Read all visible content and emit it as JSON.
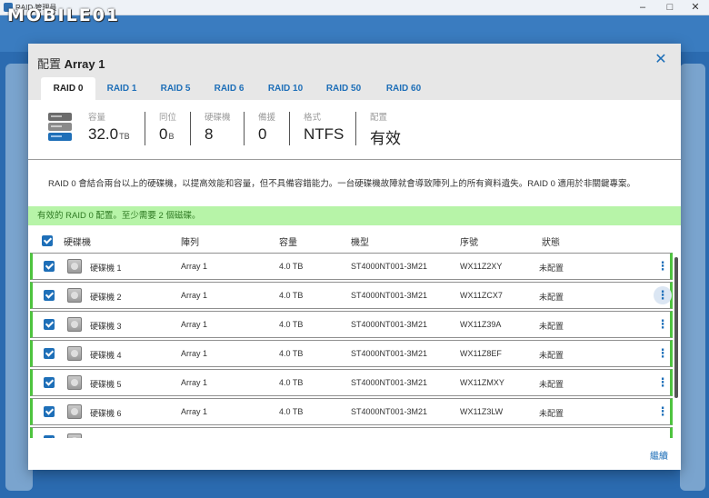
{
  "window": {
    "title": "RAID 管理員"
  },
  "watermark": "MOBILE01",
  "dialog": {
    "title_prefix": "配置",
    "title_name": "Array 1",
    "tabs": [
      "RAID 0",
      "RAID 1",
      "RAID 5",
      "RAID 6",
      "RAID 10",
      "RAID 50",
      "RAID 60"
    ],
    "active_tab": "RAID 0",
    "summary": {
      "capacity": {
        "label": "容量",
        "value": "32.0",
        "unit": "TB"
      },
      "parity": {
        "label": "同位",
        "value": "0",
        "unit": "B"
      },
      "disks": {
        "label": "硬碟機",
        "value": "8"
      },
      "spare": {
        "label": "備援",
        "value": "0"
      },
      "format": {
        "label": "格式",
        "value": "NTFS"
      },
      "config": {
        "label": "配置",
        "value": "有效"
      }
    },
    "description": "RAID 0 會結合兩台以上的硬碟機，以提高效能和容量，但不具備容錯能力。一台硬碟機故障就會導致陣列上的所有資料遺失。RAID 0 適用於非關鍵專案。",
    "alert": "有效的 RAID 0 配置。至少需要 2 個磁碟。",
    "table": {
      "headers": {
        "disk": "硬碟機",
        "array": "陣列",
        "capacity": "容量",
        "model": "機型",
        "serial": "序號",
        "status": "狀態"
      },
      "rows": [
        {
          "name": "硬碟機 1",
          "array": "Array 1",
          "capacity": "4.0 TB",
          "model": "ST4000NT001-3M21",
          "serial": "WX11Z2XY",
          "status": "未配置"
        },
        {
          "name": "硬碟機 2",
          "array": "Array 1",
          "capacity": "4.0 TB",
          "model": "ST4000NT001-3M21",
          "serial": "WX11ZCX7",
          "status": "未配置"
        },
        {
          "name": "硬碟機 3",
          "array": "Array 1",
          "capacity": "4.0 TB",
          "model": "ST4000NT001-3M21",
          "serial": "WX11Z39A",
          "status": "未配置"
        },
        {
          "name": "硬碟機 4",
          "array": "Array 1",
          "capacity": "4.0 TB",
          "model": "ST4000NT001-3M21",
          "serial": "WX11Z8EF",
          "status": "未配置"
        },
        {
          "name": "硬碟機 5",
          "array": "Array 1",
          "capacity": "4.0 TB",
          "model": "ST4000NT001-3M21",
          "serial": "WX11ZMXY",
          "status": "未配置"
        },
        {
          "name": "硬碟機 6",
          "array": "Array 1",
          "capacity": "4.0 TB",
          "model": "ST4000NT001-3M21",
          "serial": "WX11Z3LW",
          "status": "未配置"
        }
      ]
    },
    "continue_label": "繼續"
  },
  "icons": {
    "close": "close-icon",
    "menu": "kebab-menu-icon",
    "disk": "hard-disk-icon",
    "database": "database-icon"
  },
  "colors": {
    "accent": "#1e6fb8",
    "valid_bg": "#b7f4a8",
    "valid_text": "#2f7a23",
    "row_selected_border": "#4ec43f"
  }
}
